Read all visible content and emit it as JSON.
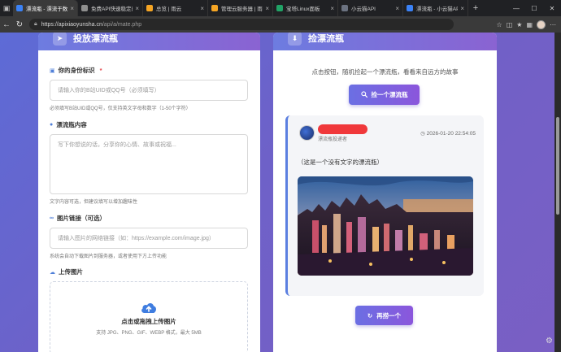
{
  "browser": {
    "tabs": [
      {
        "title": "漂流瓶 - 漂流于数字",
        "color": "#3b82f6",
        "active": true
      },
      {
        "title": "免费API快速稳定的",
        "color": "#8e8e8e",
        "active": false
      },
      {
        "title": "总览 | 雨云",
        "color": "#f5a524",
        "active": false
      },
      {
        "title": "管理云服务器 | 雨云",
        "color": "#f5a524",
        "active": false
      },
      {
        "title": "宝塔Linux面板",
        "color": "#21a366",
        "active": false
      },
      {
        "title": "小云猫API",
        "color": "#6b7280",
        "active": false
      },
      {
        "title": "漂流瓶 - 小云猫API",
        "color": "#3b82f6",
        "active": false
      }
    ],
    "url_host": "https://apixiaoyunsha.cn",
    "url_path": "/api/a/mate.php"
  },
  "left_card": {
    "title": "投放漂流瓶",
    "identity": {
      "label": "你的身份标识",
      "required_mark": "*",
      "placeholder": "请输入你的B站UID或QQ号（必须填写）",
      "hint": "必须填写B站UID或QQ号，仅支持英文字母和数字（1-50个字符）"
    },
    "content": {
      "label": "漂流瓶内容",
      "placeholder": "写下你想说的话，分享你的心情、故事或祝福...",
      "hint": "文字内容可选，但建议填写以增加趣味性"
    },
    "image_link": {
      "label": "图片链接（可选）",
      "placeholder": "请输入图片的网络链接（如：https://example.com/image.jpg）",
      "hint": "系统会自动下载图片到服务器，或者使用下方上传功能"
    },
    "upload": {
      "label": "上传图片",
      "title": "点击或拖拽上传图片",
      "subtitle": "支持 JPG、PNG、GIF、WEBP 格式，最大 5MB"
    }
  },
  "right_card": {
    "title": "捡漂流瓶",
    "description": "点击按钮，随机捡起一个漂流瓶，看看来自远方的故事",
    "pick_button": "捡一个漂流瓶",
    "again_button": "再捞一个",
    "bottle": {
      "role": "漂流瓶投递者",
      "time": "2026-01-20 22:54:05",
      "content": "（这是一个没有文字的漂流瓶）"
    }
  },
  "colors": {
    "accent": "#7b5ee0",
    "header_gradient_start": "#6d7ce0",
    "header_gradient_end": "#8a63d2",
    "required": "#e5484d"
  }
}
